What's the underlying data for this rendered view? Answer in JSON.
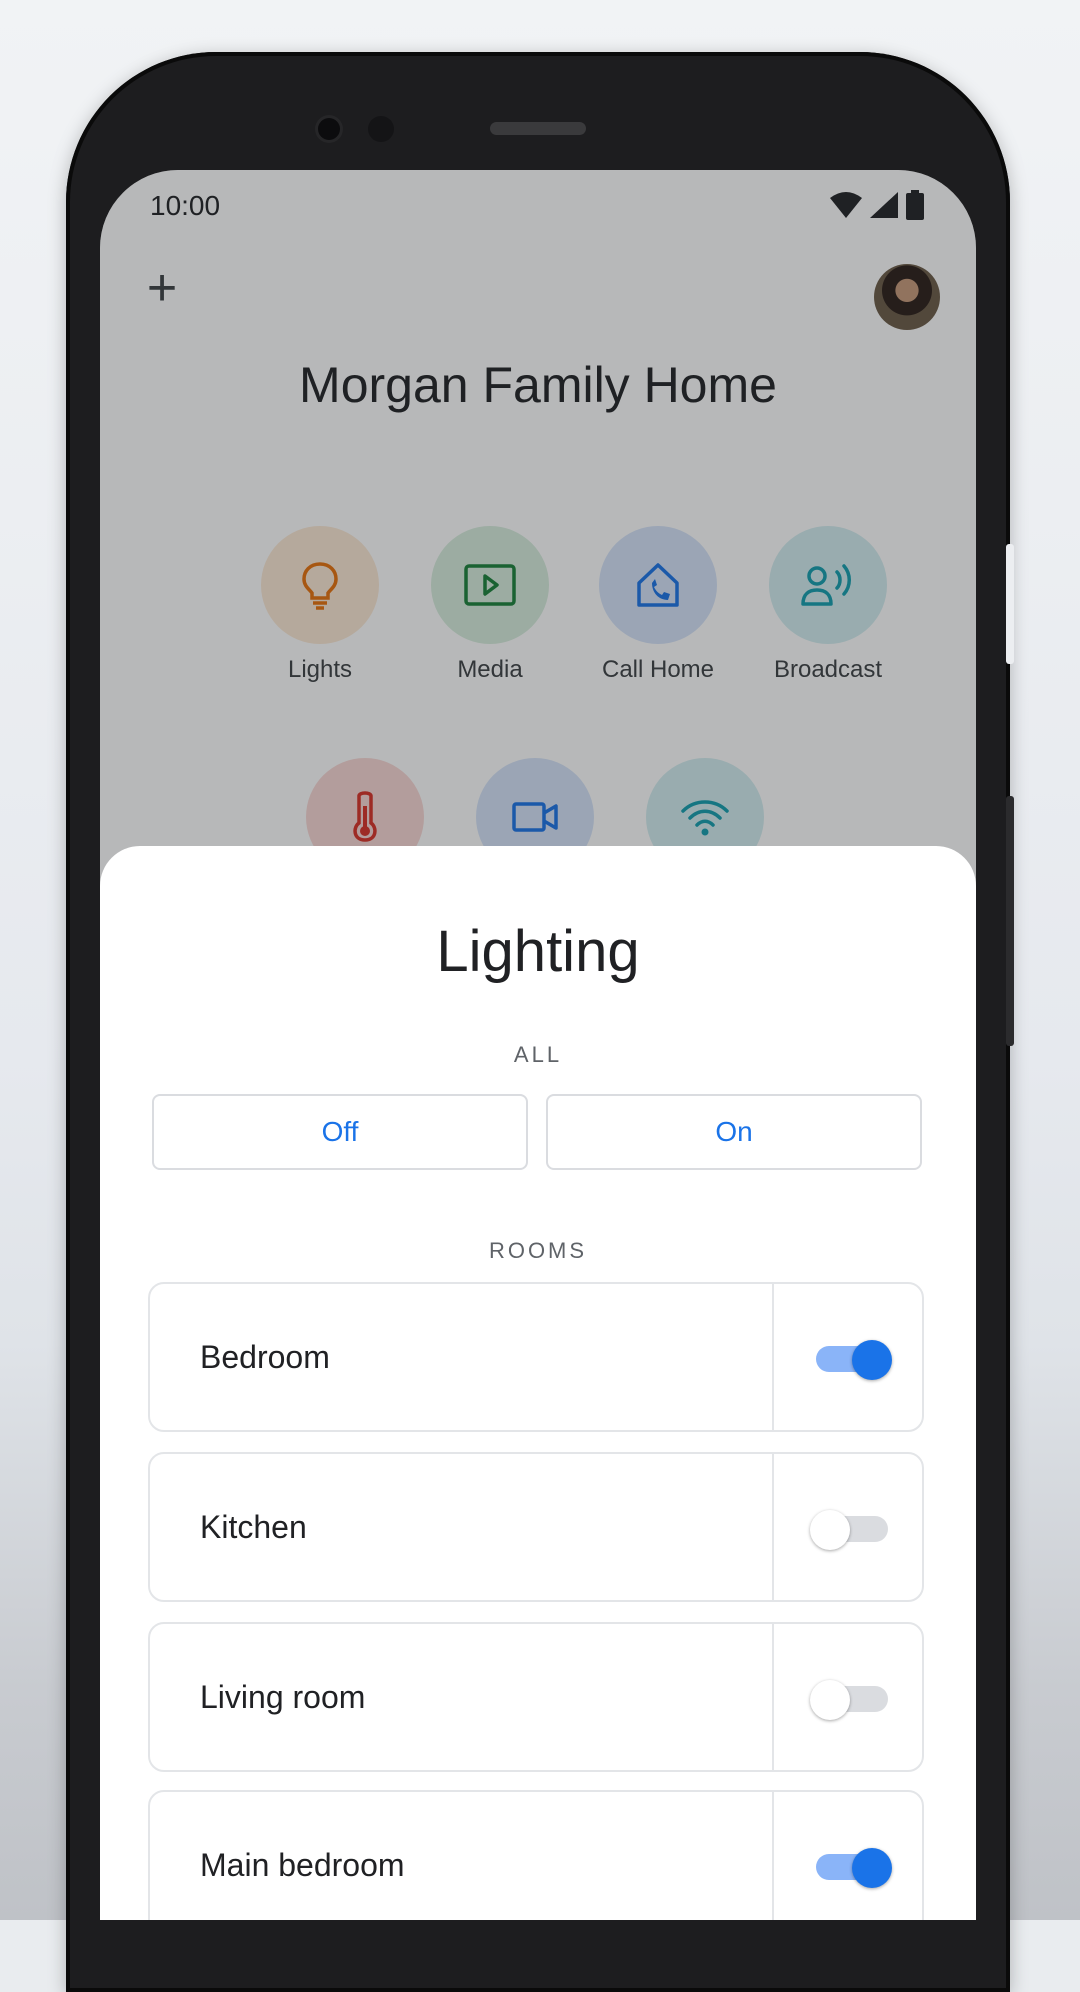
{
  "status_bar": {
    "time": "10:00"
  },
  "home": {
    "title": "Morgan Family Home",
    "quick_actions": [
      {
        "label": "Lights",
        "icon": "lightbulb-icon",
        "color": "#e8710a",
        "bg": "#fde9d4"
      },
      {
        "label": "Media",
        "icon": "play-icon",
        "color": "#188038",
        "bg": "#d7eedd"
      },
      {
        "label": "Call Home",
        "icon": "call-home-icon",
        "color": "#1a73e8",
        "bg": "#d6e4fa"
      },
      {
        "label": "Broadcast",
        "icon": "broadcast-icon",
        "color": "#129eaf",
        "bg": "#d3eef0"
      }
    ],
    "quick_actions_row2": [
      {
        "icon": "thermostat-icon",
        "color": "#d93025",
        "bg": "#fad8d5"
      },
      {
        "icon": "camera-icon",
        "color": "#1a73e8",
        "bg": "#d6e4fa"
      },
      {
        "icon": "wifi-icon",
        "color": "#129eaf",
        "bg": "#d3eef0"
      }
    ]
  },
  "lighting_sheet": {
    "title": "Lighting",
    "all_label": "ALL",
    "off_label": "Off",
    "on_label": "On",
    "rooms_label": "ROOMS",
    "rooms": [
      {
        "name": "Bedroom",
        "on": true
      },
      {
        "name": "Kitchen",
        "on": false
      },
      {
        "name": "Living room",
        "on": false
      },
      {
        "name": "Main bedroom",
        "on": true
      }
    ]
  },
  "colors": {
    "accent": "#1a73e8",
    "accent_light": "#8ab4f8"
  }
}
